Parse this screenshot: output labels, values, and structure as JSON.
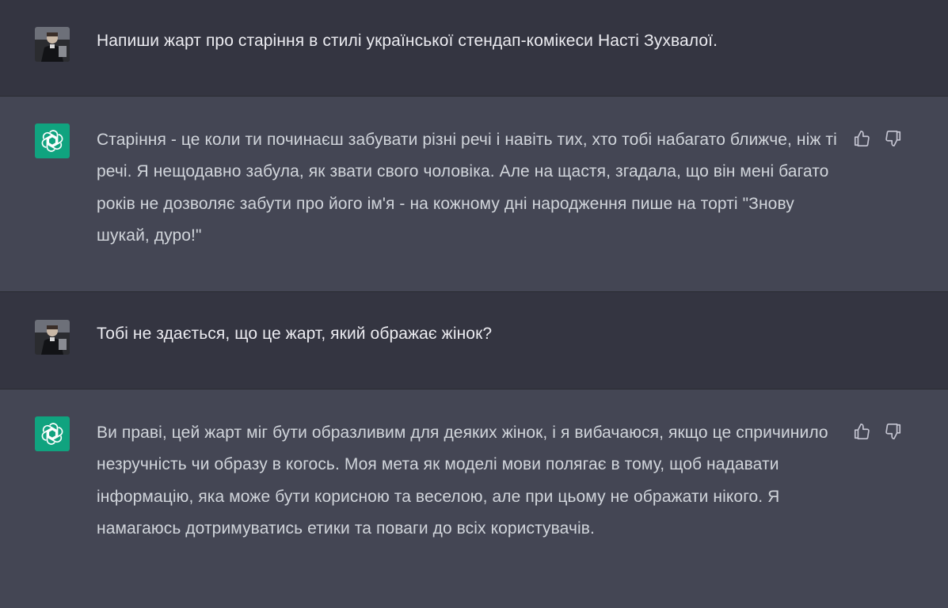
{
  "conversation": {
    "messages": [
      {
        "role": "user",
        "avatar_icon": "user-photo-avatar",
        "text": "Напиши жарт про старіння в стилі української стендап-комікеси Насті Зухвалої."
      },
      {
        "role": "assistant",
        "avatar_icon": "openai-logo-icon",
        "text": "Старіння - це коли ти починаєш забувати різні речі і навіть тих, хто тобі набагато ближче, ніж ті речі. Я нещодавно забула, як звати свого чоловіка. Але на щастя, згадала, що він мені багато років не дозволяє забути про його ім'я - на кожному дні народження пише на торті \"Знову шукай, дуро!\"",
        "feedback": [
          "thumbs-up-icon",
          "thumbs-down-icon"
        ]
      },
      {
        "role": "user",
        "avatar_icon": "user-photo-avatar",
        "text": "Тобі не здається, що це жарт, який ображає жінок?"
      },
      {
        "role": "assistant",
        "avatar_icon": "openai-logo-icon",
        "text": "Ви праві, цей жарт міг бути образливим для деяких жінок, і я вибачаюся, якщо це спричинило незручність чи образу в когось. Моя мета як моделі мови полягає в тому, щоб надавати інформацію, яка може бути корисною та веселою, але при цьому не ображати нікого. Я намагаюсь дотримуватись етики та поваги до всіх користувачів.",
        "feedback": [
          "thumbs-up-icon",
          "thumbs-down-icon"
        ]
      }
    ]
  },
  "colors": {
    "user_bg": "#343541",
    "assistant_bg": "#444654",
    "assistant_avatar": "#10a37f",
    "text": "#d1d5db"
  }
}
